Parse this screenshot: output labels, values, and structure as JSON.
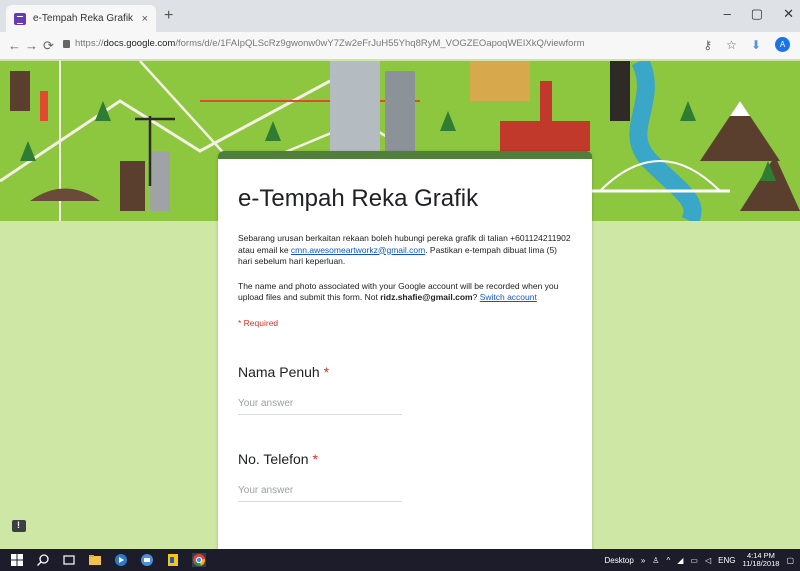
{
  "browser": {
    "tab_title": "e-Tempah Reka Grafik",
    "tab_close": "×",
    "new_tab": "+",
    "url_prefix": "https://",
    "url_host": "docs.google.com",
    "url_path": "/forms/d/e/1FAIpQLScRz9gwonw0wY7Zw2eFrJuH55Yhq8RyM_VOGZEOapoqWEIXkQ/viewform",
    "avatar_letter": "A",
    "window_controls": [
      "–",
      "▢",
      "✕"
    ]
  },
  "form": {
    "title": "e-Tempah Reka Grafik",
    "desc_part1": "Sebarang urusan berkaitan rekaan boleh hubungi pereka grafik di talian +601124211902 atau email ke ",
    "email_link": "cmn.awesomeartworkz@gmail.com",
    "desc_part2": ". Pastikan e-tempah dibuat lima (5) hari sebelum hari keperluan.",
    "account_note_1": "The name and photo associated with your Google account will be recorded when you upload files and submit this form. Not ",
    "account_email": "ridz.shafie@gmail.com",
    "account_note_2": "? ",
    "switch_account": "Switch account",
    "required_note": "* Required",
    "questions": [
      {
        "label": "Nama Penuh",
        "star": "*",
        "placeholder": "Your answer"
      },
      {
        "label": "No. Telefon",
        "star": "*",
        "placeholder": "Your answer"
      }
    ]
  },
  "taskbar": {
    "desktop_label": "Desktop",
    "chevron": "»",
    "language": "ENG",
    "time": "4:14 PM",
    "date": "11/18/2018"
  },
  "colors": {
    "accent": "#4f7f3a",
    "required": "#d93025",
    "link": "#1155cc",
    "background": "#cfe7a4"
  }
}
